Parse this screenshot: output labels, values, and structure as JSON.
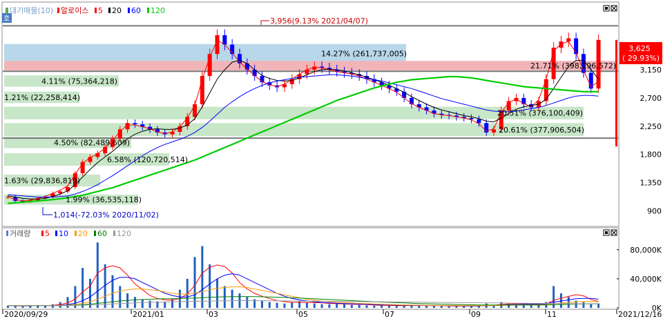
{
  "header": {
    "tab_icon": "호",
    "title_label": "대기매물(10)",
    "name": "알로이스",
    "ma_legend": [
      {
        "label": "5",
        "color": "#ff0000"
      },
      {
        "label": "20",
        "color": "#000000"
      },
      {
        "label": "60",
        "color": "#0000ff"
      },
      {
        "label": "120",
        "color": "#00cc00"
      }
    ]
  },
  "volume_header": {
    "title": "거래량",
    "ma_legend": [
      {
        "label": "5",
        "color": "#ff0000"
      },
      {
        "label": "10",
        "color": "#0000ff"
      },
      {
        "label": "20",
        "color": "#ff9900"
      },
      {
        "label": "60",
        "color": "#008000"
      },
      {
        "label": "120",
        "color": "#999999"
      }
    ]
  },
  "chart_data": {
    "type": "candlestick",
    "price_axis": {
      "ticks": [
        3150,
        2700,
        2250,
        1800,
        1350,
        900
      ],
      "tick_labels": [
        "3,150",
        "2,700",
        "2,250",
        "1,800",
        "1,350",
        "900"
      ],
      "range": [
        675,
        3975
      ]
    },
    "volume_axis": {
      "ticks": [
        80000,
        40000,
        0
      ],
      "tick_labels": [
        "80,000K",
        "40,000K",
        "0K"
      ],
      "range": [
        0,
        95000
      ]
    },
    "x_labels": [
      "2020/09/29",
      "2021/01",
      "03",
      "05",
      "07",
      "09",
      "11",
      "2021/12/16"
    ],
    "current_price": {
      "value": "3,625",
      "change": "( 29.93%)"
    },
    "annotations": {
      "high": "3,956(9.13% 2021/04/07)",
      "low": "1,014(-72.03% 2020/11/02)"
    },
    "support_lines": [
      3850,
      3125,
      2060
    ],
    "supply_bands": [
      {
        "label": "14.27% (261,737,005)",
        "low": 3260,
        "high": 3560,
        "color": "#b9d7ea"
      },
      {
        "label": "21.71% (398,196,572)",
        "low": 3140,
        "high": 3290,
        "color": "#f1b4b8"
      },
      {
        "label": "4.11% (75,364,218)",
        "low": 2880,
        "high": 3060,
        "color": "#c8e6c8"
      },
      {
        "label": "1.21% (22,258,414)",
        "low": 2620,
        "high": 2800,
        "color": "#c8e6c8"
      },
      {
        "label": "20.51% (376,100,409)",
        "low": 2360,
        "high": 2560,
        "color": "#c8e6c8"
      },
      {
        "label": "20.61% (377,906,504)",
        "low": 2090,
        "high": 2300,
        "color": "#c8e6c8"
      },
      {
        "label": "4.50% (82,489,609)",
        "low": 1900,
        "high": 2080,
        "color": "#c8e6c8"
      },
      {
        "label": "6.58% (120,720,514)",
        "low": 1620,
        "high": 1820,
        "color": "#c8e6c8"
      },
      {
        "label": "1.63% (29,836,819)",
        "low": 1290,
        "high": 1480,
        "color": "#c8e6c8"
      },
      {
        "label": "1.99% (36,535,118)",
        "low": 1000,
        "high": 1160,
        "color": "#c8e6c8"
      }
    ],
    "price_path": [
      1120,
      1060,
      1050,
      1070,
      1100,
      1120,
      1180,
      1210,
      1280,
      1500,
      1680,
      1760,
      1820,
      1920,
      2050,
      2200,
      2300,
      2280,
      2240,
      2200,
      2150,
      2120,
      2160,
      2250,
      2400,
      2600,
      3050,
      3400,
      3700,
      3550,
      3400,
      3250,
      3150,
      3050,
      2950,
      2900,
      2870,
      2920,
      3000,
      3080,
      3150,
      3200,
      3180,
      3150,
      3120,
      3100,
      3080,
      3050,
      3000,
      2950,
      2900,
      2850,
      2800,
      2700,
      2600,
      2550,
      2500,
      2450,
      2430,
      2420,
      2400,
      2380,
      2360,
      2300,
      2150,
      2200,
      2500,
      2650,
      2700,
      2600,
      2550,
      2650,
      3000,
      3500,
      3600,
      3650,
      3400,
      3100,
      2850,
      3625
    ],
    "ma_series": [
      {
        "name": "5",
        "color": "#ff0000",
        "values": [
          1120,
          1080,
          1060,
          1070,
          1100,
          1130,
          1180,
          1230,
          1300,
          1480,
          1660,
          1750,
          1810,
          1900,
          2020,
          2170,
          2270,
          2270,
          2240,
          2210,
          2160,
          2130,
          2160,
          2240,
          2380,
          2580,
          3000,
          3350,
          3620,
          3550,
          3420,
          3270,
          3160,
          3060,
          2960,
          2910,
          2880,
          2920,
          3000,
          3080,
          3150,
          3190,
          3180,
          3150,
          3120,
          3100,
          3080,
          3050,
          3000,
          2950,
          2900,
          2850,
          2790,
          2700,
          2610,
          2550,
          2500,
          2450,
          2430,
          2420,
          2400,
          2380,
          2350,
          2290,
          2170,
          2210,
          2470,
          2630,
          2680,
          2610,
          2560,
          2670,
          3000,
          3450,
          3560,
          3600,
          3420,
          3140,
          2880,
          2960
        ]
      },
      {
        "name": "20",
        "color": "#000000",
        "values": [
          1140,
          1120,
          1100,
          1090,
          1090,
          1100,
          1130,
          1170,
          1220,
          1320,
          1440,
          1560,
          1670,
          1760,
          1850,
          1950,
          2050,
          2120,
          2170,
          2200,
          2210,
          2200,
          2200,
          2220,
          2270,
          2370,
          2560,
          2780,
          3000,
          3150,
          3270,
          3300,
          3250,
          3150,
          3060,
          3010,
          2980,
          2970,
          2980,
          3020,
          3070,
          3120,
          3150,
          3160,
          3150,
          3130,
          3100,
          3070,
          3030,
          2990,
          2950,
          2900,
          2850,
          2790,
          2720,
          2660,
          2600,
          2550,
          2510,
          2480,
          2450,
          2420,
          2400,
          2370,
          2330,
          2320,
          2380,
          2450,
          2520,
          2560,
          2580,
          2600,
          2680,
          2850,
          3030,
          3200,
          3300,
          3300,
          3150,
          3000
        ]
      },
      {
        "name": "60",
        "color": "#0000ff",
        "values": [
          1160,
          1150,
          1140,
          1130,
          1120,
          1120,
          1120,
          1130,
          1140,
          1170,
          1210,
          1260,
          1320,
          1390,
          1460,
          1540,
          1620,
          1700,
          1780,
          1850,
          1910,
          1960,
          2000,
          2040,
          2090,
          2150,
          2230,
          2330,
          2440,
          2550,
          2640,
          2720,
          2790,
          2850,
          2900,
          2940,
          2970,
          2990,
          3010,
          3030,
          3040,
          3050,
          3060,
          3070,
          3070,
          3060,
          3050,
          3030,
          3010,
          2990,
          2970,
          2940,
          2910,
          2880,
          2850,
          2810,
          2770,
          2730,
          2690,
          2660,
          2630,
          2600,
          2570,
          2540,
          2510,
          2490,
          2480,
          2480,
          2490,
          2510,
          2530,
          2550,
          2580,
          2620,
          2660,
          2700,
          2730,
          2740,
          2740,
          2730
        ]
      },
      {
        "name": "120",
        "color": "#00cc00",
        "values": [
          1020,
          1030,
          1040,
          1050,
          1060,
          1070,
          1080,
          1095,
          1110,
          1130,
          1150,
          1180,
          1210,
          1240,
          1270,
          1310,
          1350,
          1390,
          1430,
          1470,
          1510,
          1550,
          1590,
          1630,
          1670,
          1710,
          1760,
          1810,
          1860,
          1910,
          1960,
          2010,
          2060,
          2110,
          2160,
          2210,
          2260,
          2310,
          2360,
          2410,
          2460,
          2510,
          2560,
          2610,
          2660,
          2700,
          2740,
          2780,
          2820,
          2860,
          2890,
          2920,
          2950,
          2970,
          2990,
          3000,
          3010,
          3020,
          3030,
          3040,
          3040,
          3030,
          3020,
          3000,
          2980,
          2960,
          2940,
          2920,
          2900,
          2880,
          2870,
          2860,
          2850,
          2840,
          2830,
          2820,
          2810,
          2800,
          2800,
          2800
        ]
      }
    ],
    "volume_bars": [
      3000,
      2500,
      2000,
      3500,
      4000,
      3000,
      5000,
      8000,
      15000,
      30000,
      55000,
      40000,
      90000,
      60000,
      45000,
      30000,
      20000,
      15000,
      12000,
      10000,
      9000,
      8000,
      12000,
      25000,
      40000,
      70000,
      85000,
      60000,
      40000,
      30000,
      25000,
      20000,
      15000,
      12000,
      10000,
      8000,
      7000,
      6000,
      8000,
      9000,
      7000,
      6000,
      5000,
      5000,
      6000,
      5000,
      4000,
      4000,
      3500,
      3000,
      3500,
      3000,
      2500,
      3000,
      4000,
      3500,
      3000,
      2500,
      2500,
      2000,
      2500,
      3000,
      2500,
      3000,
      6000,
      4000,
      8000,
      6000,
      5000,
      4000,
      3500,
      5000,
      8000,
      30000,
      20000,
      15000,
      10000,
      8000,
      5000,
      6000
    ],
    "volume_ma": [
      {
        "name": "5",
        "color": "#ff0000",
        "values": [
          3000,
          2800,
          2600,
          2800,
          3000,
          3200,
          3500,
          4500,
          7000,
          12000,
          22000,
          30000,
          48000,
          55000,
          58000,
          55000,
          45000,
          33000,
          25000,
          17000,
          13000,
          11000,
          10500,
          13000,
          19000,
          31000,
          48000,
          56000,
          59000,
          57000,
          48000,
          35000,
          26000,
          20000,
          16000,
          13000,
          10000,
          8600,
          7600,
          7600,
          7400,
          7200,
          7000,
          6200,
          5800,
          5400,
          5000,
          4800,
          4500,
          3900,
          3600,
          3400,
          3100,
          3000,
          3200,
          3200,
          3200,
          3100,
          3100,
          2700,
          2500,
          2500,
          2500,
          2600,
          3400,
          3700,
          4700,
          5400,
          5800,
          5800,
          5300,
          4700,
          5300,
          10300,
          13300,
          15800,
          18200,
          16600,
          11600,
          8800
        ]
      },
      {
        "name": "10",
        "color": "#0000ff",
        "values": [
          3000,
          2900,
          2800,
          2800,
          2900,
          3000,
          3200,
          3600,
          4500,
          6500,
          10000,
          15000,
          23000,
          31000,
          38000,
          42000,
          42000,
          40000,
          35000,
          30000,
          25000,
          20000,
          17000,
          15000,
          15000,
          18000,
          25000,
          33000,
          40000,
          45000,
          47000,
          45000,
          40000,
          35000,
          30000,
          25000,
          20000,
          16000,
          13000,
          11000,
          9500,
          8500,
          7500,
          7000,
          6500,
          6000,
          5600,
          5200,
          4900,
          4600,
          4300,
          4000,
          3800,
          3600,
          3500,
          3400,
          3300,
          3200,
          3100,
          3000,
          2900,
          2800,
          2800,
          2800,
          3100,
          3300,
          3800,
          4300,
          4700,
          5000,
          5100,
          5300,
          5700,
          7800,
          9500,
          11000,
          12500,
          13000,
          13000,
          12000
        ]
      },
      {
        "name": "20",
        "color": "#ff9900",
        "values": [
          3000,
          3000,
          2900,
          2900,
          2900,
          3000,
          3100,
          3300,
          3800,
          4800,
          6500,
          8500,
          12000,
          16000,
          20000,
          23000,
          25000,
          26000,
          26000,
          25000,
          24000,
          22000,
          20000,
          19000,
          19000,
          20000,
          22000,
          25000,
          27000,
          28000,
          29000,
          29000,
          28000,
          26000,
          24000,
          22000,
          20000,
          18000,
          16000,
          14000,
          12000,
          10500,
          9500,
          8500,
          7800,
          7200,
          6700,
          6200,
          5800,
          5400,
          5000,
          4700,
          4400,
          4100,
          3900,
          3700,
          3500,
          3400,
          3300,
          3200,
          3100,
          3000,
          3000,
          3000,
          3100,
          3200,
          3500,
          3800,
          4000,
          4200,
          4300,
          4400,
          4600,
          5800,
          6700,
          7500,
          8200,
          8600,
          8700,
          8500
        ]
      },
      {
        "name": "60",
        "color": "#008000",
        "values": [
          3000,
          3000,
          3000,
          3000,
          3000,
          3000,
          3100,
          3200,
          3400,
          3800,
          4400,
          5100,
          6200,
          7400,
          8500,
          9500,
          10300,
          11000,
          11500,
          12000,
          12300,
          12500,
          12700,
          12900,
          13200,
          13600,
          14100,
          14600,
          15000,
          15300,
          15500,
          15600,
          15600,
          15500,
          15300,
          15000,
          14700,
          14300,
          13900,
          13500,
          13000,
          12500,
          12000,
          11500,
          11000,
          10500,
          10000,
          9500,
          9000,
          8500,
          8000,
          7600,
          7200,
          6800,
          6400,
          6000,
          5700,
          5400,
          5100,
          4900,
          4700,
          4500,
          4300,
          4100,
          4000,
          3900,
          3900,
          3900,
          3900,
          3900,
          3900,
          3900,
          4000,
          4400,
          4700,
          5000,
          5300,
          5500,
          5600,
          5600
        ]
      },
      {
        "name": "120",
        "color": "#999999",
        "values": [
          3000,
          3000,
          3000,
          3000,
          3000,
          3000,
          3000,
          3100,
          3200,
          3400,
          3700,
          4000,
          4500,
          5000,
          5500,
          6000,
          6500,
          6900,
          7300,
          7600,
          7900,
          8200,
          8400,
          8600,
          8800,
          9000,
          9200,
          9400,
          9600,
          9800,
          9900,
          10000,
          10000,
          10000,
          9900,
          9800,
          9700,
          9600,
          9500,
          9400,
          9300,
          9200,
          9100,
          9000,
          8900,
          8800,
          8700,
          8600,
          8500,
          8400,
          8300,
          8200,
          8100,
          8000,
          7900,
          7800,
          7700,
          7600,
          7500,
          7400,
          7300,
          7200,
          7100,
          7000,
          6900,
          6800,
          6700,
          6600,
          6500,
          6400,
          6300,
          6200,
          6100,
          6000,
          5900,
          5800,
          5700,
          5600,
          5500,
          5400
        ]
      }
    ]
  }
}
